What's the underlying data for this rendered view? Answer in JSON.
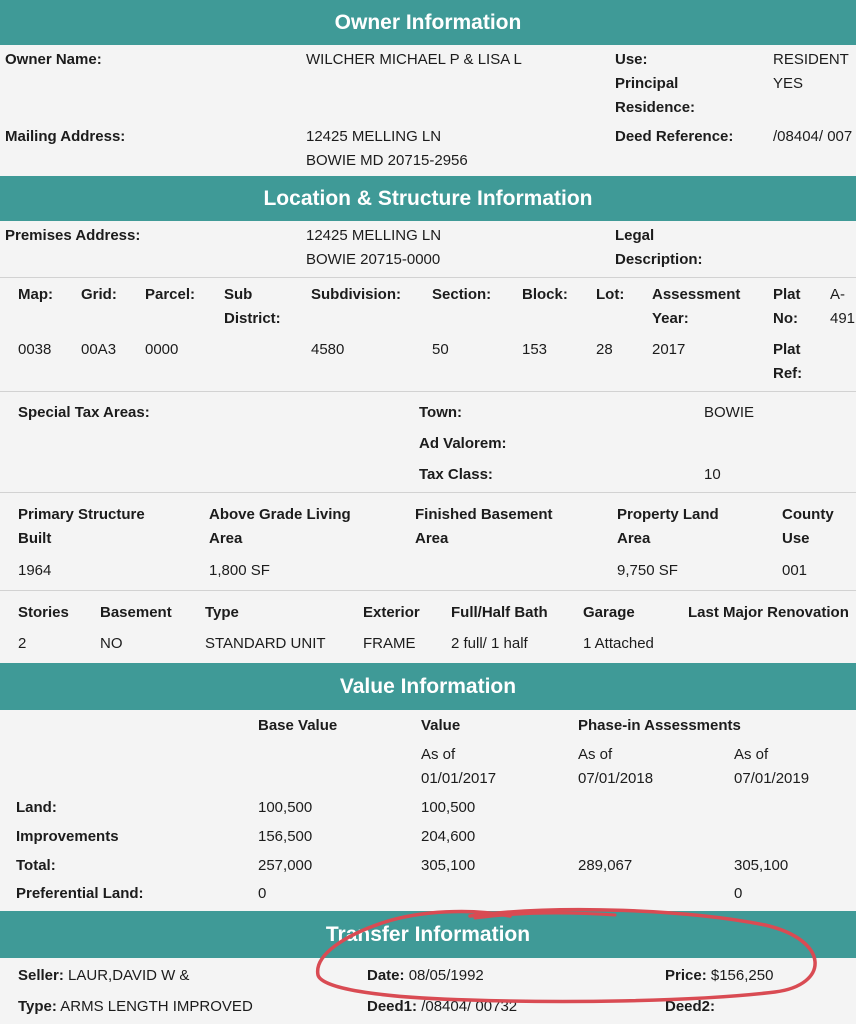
{
  "headers": {
    "owner": "Owner Information",
    "location": "Location & Structure Information",
    "value": "Value Information",
    "transfer": "Transfer Information"
  },
  "owner": {
    "name_label": "Owner Name:",
    "name_value": "WILCHER MICHAEL P & LISA L",
    "use_label": "Use:",
    "use_value": "RESIDENT",
    "principal_label_1": "Principal",
    "principal_label_2": "Residence:",
    "principal_value": "YES",
    "mailing_label": "Mailing Address:",
    "mailing_line1": "12425 MELLING LN",
    "mailing_line2": "BOWIE MD 20715-2956",
    "deed_label": "Deed Reference:",
    "deed_value": "/08404/ 007"
  },
  "location": {
    "premises_label": "Premises Address:",
    "premises_line1": "12425 MELLING LN",
    "premises_line2": "BOWIE 20715-0000",
    "legal_label_1": "Legal",
    "legal_label_2": "Description:",
    "map_label": "Map:",
    "grid_label": "Grid:",
    "parcel_label": "Parcel:",
    "subdistrict_label_1": "Sub",
    "subdistrict_label_2": "District:",
    "subdivision_label": "Subdivision:",
    "section_label": "Section:",
    "block_label": "Block:",
    "lot_label": "Lot:",
    "assess_year_label_1": "Assessment",
    "assess_year_label_2": "Year:",
    "plat_no_label_1": "Plat",
    "plat_no_label_2": "No:",
    "plat_no_value_1": "A-",
    "plat_no_value_2": "491",
    "map_value": "0038",
    "grid_value": "00A3",
    "parcel_value": "0000",
    "subdivision_value": "4580",
    "section_value": "50",
    "block_value": "153",
    "lot_value": "28",
    "assess_year_value": "2017",
    "plat_ref_label_1": "Plat",
    "plat_ref_label_2": "Ref:",
    "special_tax_label": "Special Tax Areas:",
    "town_label": "Town:",
    "town_value": "BOWIE",
    "ad_valorem_label": "Ad Valorem:",
    "tax_class_label": "Tax Class:",
    "tax_class_value": "10",
    "primary_built_label_1": "Primary Structure",
    "primary_built_label_2": "Built",
    "living_area_label_1": "Above Grade Living",
    "living_area_label_2": "Area",
    "basement_area_label_1": "Finished Basement",
    "basement_area_label_2": "Area",
    "land_area_label_1": "Property Land",
    "land_area_label_2": "Area",
    "county_use_label_1": "County",
    "county_use_label_2": "Use",
    "primary_built_value": "1964",
    "living_area_value": "1,800 SF",
    "land_area_value": "9,750 SF",
    "county_use_value": "001",
    "stories_label": "Stories",
    "basement_label": "Basement",
    "type_label": "Type",
    "exterior_label": "Exterior",
    "bath_label": "Full/Half Bath",
    "garage_label": "Garage",
    "renovation_label": "Last Major Renovation",
    "stories_value": "2",
    "basement_value": "NO",
    "type_value": "STANDARD UNIT",
    "exterior_value": "FRAME",
    "bath_value": "2 full/ 1 half",
    "garage_value": "1 Attached"
  },
  "value": {
    "base_value_label": "Base Value",
    "value_label": "Value",
    "phase_in_label": "Phase-in Assessments",
    "as_of_label": "As of",
    "value_date": "01/01/2017",
    "phase1_date": "07/01/2018",
    "phase2_date": "07/01/2019",
    "rows": [
      {
        "label": "Land:",
        "base": "100,500",
        "value": "100,500",
        "phase1": "",
        "phase2": ""
      },
      {
        "label": "Improvements",
        "base": "156,500",
        "value": "204,600",
        "phase1": "",
        "phase2": ""
      },
      {
        "label": "Total:",
        "base": "257,000",
        "value": "305,100",
        "phase1": "289,067",
        "phase2": "305,100"
      },
      {
        "label": "Preferential Land:",
        "base": "0",
        "value": "",
        "phase1": "",
        "phase2": "0"
      }
    ]
  },
  "transfer": {
    "seller_label": "Seller:",
    "seller_value": "LAUR,DAVID W &",
    "date_label": "Date:",
    "date_value": "08/05/1992",
    "price_label": "Price:",
    "price_value": "$156,250",
    "type_label": "Type:",
    "type_value": "ARMS LENGTH IMPROVED",
    "deed1_label": "Deed1:",
    "deed1_value": "/08404/ 00732",
    "deed2_label": "Deed2:"
  },
  "annotation": {
    "stroke_color": "#d94b53"
  }
}
